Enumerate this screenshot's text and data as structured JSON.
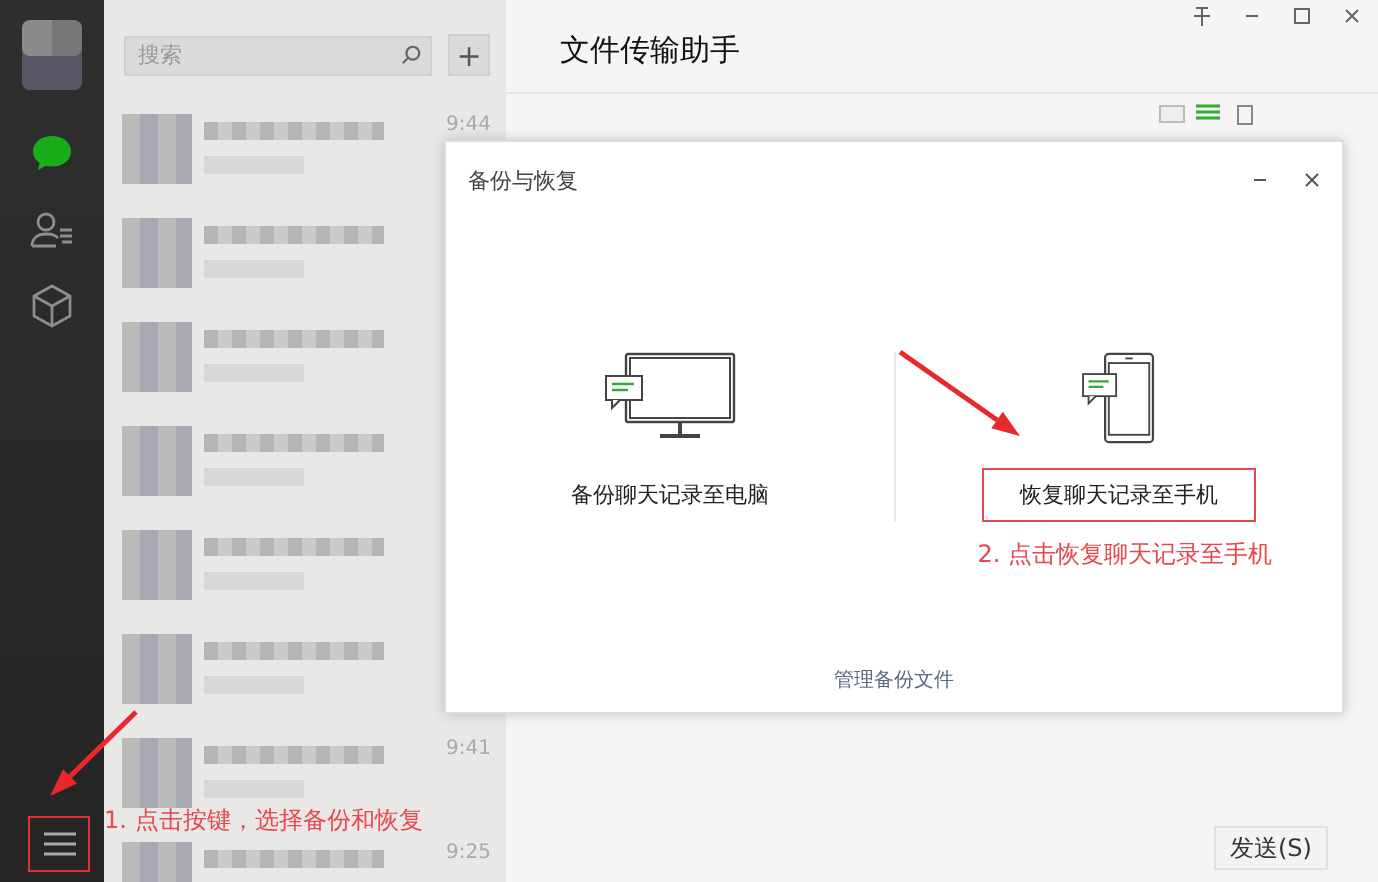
{
  "sidebar": {
    "items": [
      {
        "kind": "avatar"
      },
      {
        "kind": "chat",
        "selected": true
      },
      {
        "kind": "contacts",
        "selected": false
      },
      {
        "kind": "box",
        "selected": false
      }
    ]
  },
  "search": {
    "placeholder": "搜索"
  },
  "add_button": {
    "label": "+"
  },
  "chats": [
    {
      "kind": "blurred",
      "time": "9:44"
    },
    {
      "kind": "blurred"
    },
    {
      "kind": "blurred"
    },
    {
      "kind": "blurred"
    },
    {
      "kind": "blurred"
    },
    {
      "kind": "blurred"
    },
    {
      "kind": "blurred",
      "time": "9:41"
    },
    {
      "kind": "blurred",
      "time": "9:25"
    }
  ],
  "conversation": {
    "title": "文件传输助手",
    "send_button": "发送(S)"
  },
  "dialog": {
    "title": "备份与恢复",
    "options": [
      {
        "kind": "computer",
        "label": "备份聊天记录至电脑",
        "highlighted": false
      },
      {
        "kind": "phone",
        "label": "恢复聊天记录至手机",
        "highlighted": true
      }
    ],
    "link": "管理备份文件"
  },
  "annotations": [
    {
      "text": "1. 点击按键，选择备份和恢复"
    },
    {
      "text": "2. 点击恢复聊天记录至手机"
    }
  ]
}
